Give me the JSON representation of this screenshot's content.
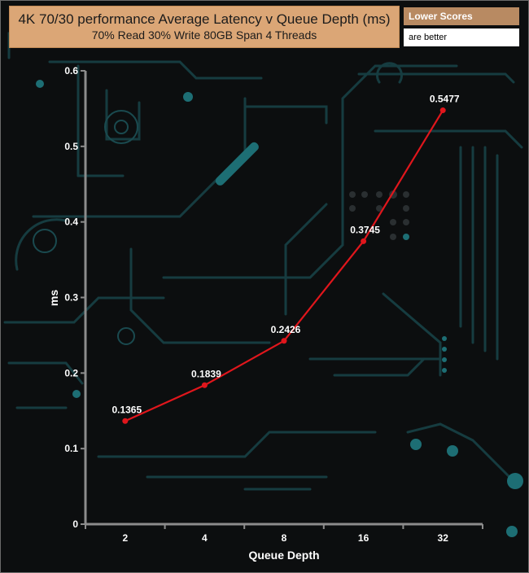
{
  "header": {
    "title": "4K 70/30 performance Average Latency v Queue Depth (ms)",
    "subtitle": "70% Read 30% Write 80GB Span 4 Threads"
  },
  "legend": {
    "line1": "Lower Scores",
    "line2": "are better"
  },
  "colors": {
    "series": "#e0161c",
    "axis": "#8c8c8c",
    "label_text": "#ffffff",
    "title_bg": "#dba676"
  },
  "chart_data": {
    "type": "line",
    "title": "4K 70/30 performance Average Latency v Queue Depth (ms)",
    "subtitle": "70% Read 30% Write 80GB Span 4 Threads",
    "xlabel": "Queue Depth",
    "ylabel": "ms",
    "categories": [
      "2",
      "4",
      "8",
      "16",
      "32"
    ],
    "series": [
      {
        "values": [
          0.1365,
          0.1839,
          0.2426,
          0.3745,
          0.5477
        ]
      }
    ],
    "data_labels": [
      "0.1365",
      "0.1839",
      "0.2426",
      "0.3745",
      "0.5477"
    ],
    "ylim": [
      0,
      0.6
    ],
    "yticks": [
      "0",
      "0.1",
      "0.2",
      "0.3",
      "0.4",
      "0.5",
      "0.6"
    ],
    "grid": false,
    "legend_position": "top-right"
  }
}
